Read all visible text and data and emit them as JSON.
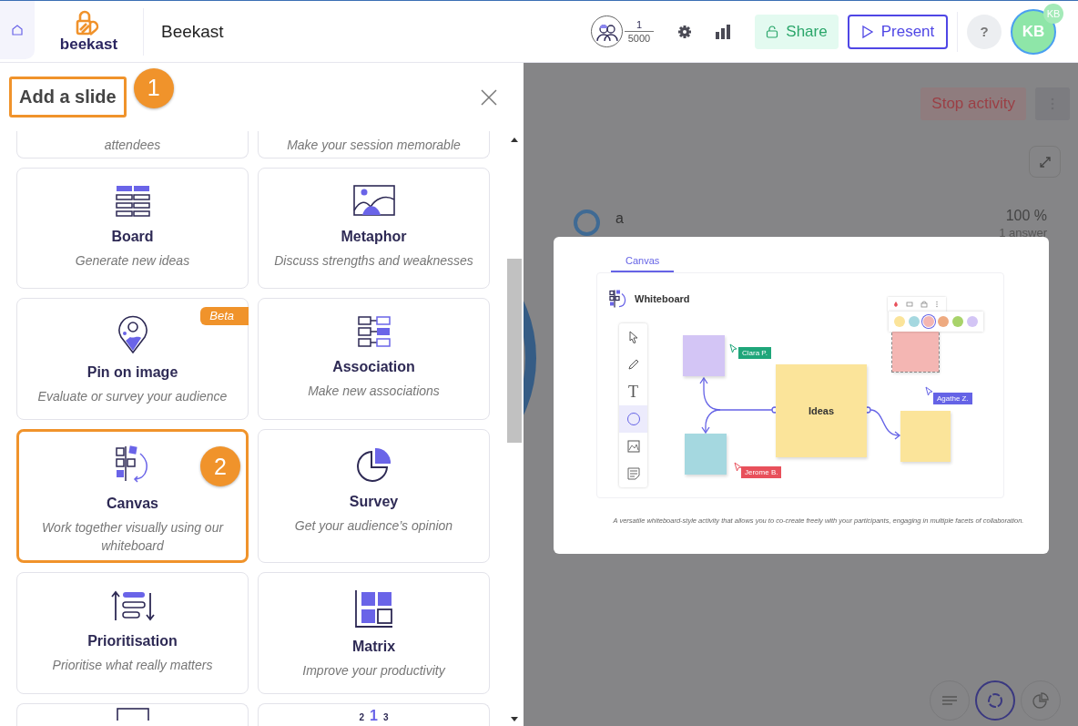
{
  "header": {
    "logo_text": "beekast",
    "title": "Beekast",
    "participants": {
      "count": "1",
      "max": "5000"
    },
    "share": "Share",
    "present": "Present",
    "help": "?",
    "avatar": {
      "initials": "KB",
      "badge": "KB"
    }
  },
  "panel": {
    "title": "Add a slide",
    "title_callout": "1",
    "cut_top": [
      {
        "description": "attendees"
      },
      {
        "description": "Make your session memorable"
      }
    ],
    "cards": [
      {
        "kind": "board",
        "title": "Board",
        "description": "Generate new ideas",
        "selected": false
      },
      {
        "kind": "metaphor",
        "title": "Metaphor",
        "description": "Discuss strengths and weaknesses",
        "selected": false
      },
      {
        "kind": "pin",
        "title": "Pin on image",
        "description": "Evaluate or survey your audience",
        "badge": "Beta",
        "selected": false
      },
      {
        "kind": "association",
        "title": "Association",
        "description": "Make new associations",
        "selected": false
      },
      {
        "kind": "canvas",
        "title": "Canvas",
        "description": "Work together visually using our whiteboard",
        "callout": "2",
        "selected": true
      },
      {
        "kind": "survey",
        "title": "Survey",
        "description": "Get your audience’s opinion",
        "selected": false
      },
      {
        "kind": "prioritisation",
        "title": "Prioritisation",
        "description": "Prioritise what really matters",
        "selected": false
      },
      {
        "kind": "matrix",
        "title": "Matrix",
        "description": "Improve your productivity",
        "selected": false
      }
    ],
    "cut_bottom": [
      {
        "kind": "frame"
      },
      {
        "kind": "ranking",
        "icon_labels": [
          "2",
          "1",
          "3"
        ]
      }
    ]
  },
  "background": {
    "stop_button": "Stop activity",
    "answer": {
      "label": "a",
      "percent": "100 %",
      "count": "1 answer"
    }
  },
  "preview": {
    "tab": "Canvas",
    "board_title": "Whiteboard",
    "center_note": "Ideas",
    "tools": [
      {
        "kind": "pointer",
        "selected": false
      },
      {
        "kind": "pencil",
        "selected": false
      },
      {
        "kind": "text",
        "glyph": "T",
        "selected": false
      },
      {
        "kind": "circle",
        "selected": true
      },
      {
        "kind": "image",
        "selected": false
      },
      {
        "kind": "note",
        "selected": false
      }
    ],
    "palette": [
      {
        "color": "#fbe49a",
        "selected": false
      },
      {
        "color": "#a5d8e0",
        "selected": false
      },
      {
        "color": "#f4b6b3",
        "selected": true
      },
      {
        "color": "#eeaa80",
        "selected": false
      },
      {
        "color": "#a8d36a",
        "selected": false
      },
      {
        "color": "#d3c5f5",
        "selected": false
      }
    ],
    "cursors": [
      {
        "name": "Clara P.",
        "color": "#1fa67a"
      },
      {
        "name": "Jerome B.",
        "color": "#e8505b"
      },
      {
        "name": "Agathe Z.",
        "color": "#6563e6"
      }
    ],
    "caption": "A versatile whiteboard-style activity that allows you to co-create freely with your participants, engaging in multiple facets of collaboration."
  }
}
